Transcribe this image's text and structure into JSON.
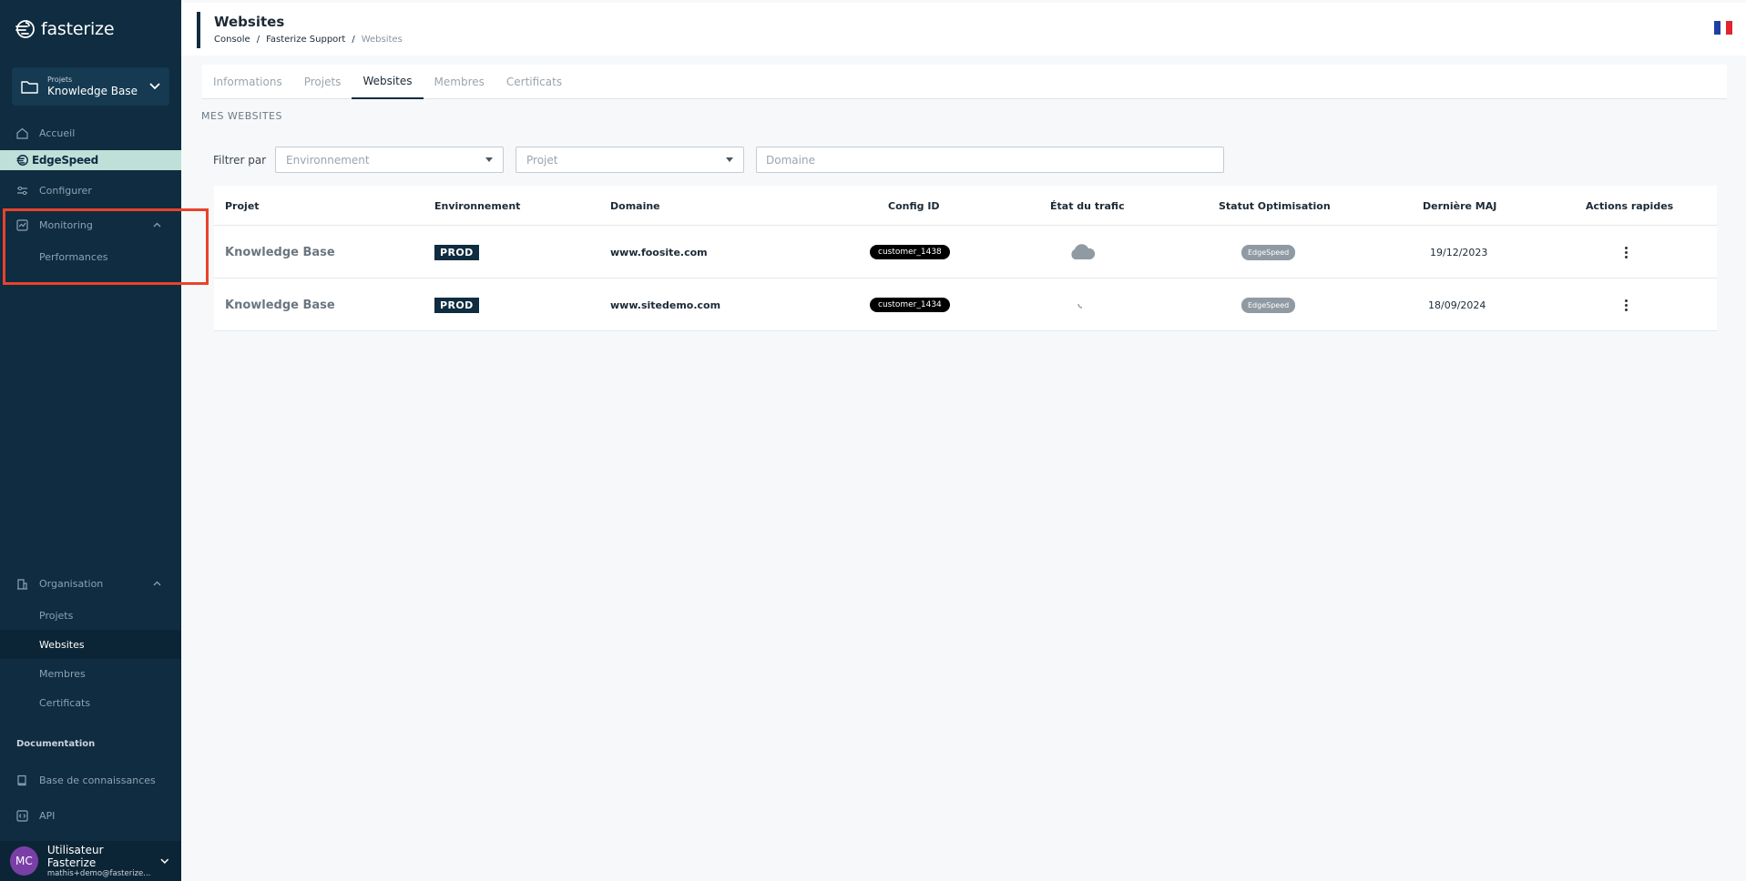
{
  "sidebar": {
    "logo_text": "fasterize",
    "project_select": {
      "small_label": "Projets",
      "value": "Knowledge Base"
    },
    "nav": {
      "accueil": "Accueil",
      "edgespeed": "EdgeSpeed",
      "configurer": "Configurer",
      "monitoring": "Monitoring",
      "performances": "Performances",
      "organisation": "Organisation",
      "projets": "Projets",
      "websites": "Websites",
      "membres": "Membres",
      "certificats": "Certificats"
    },
    "documentation": {
      "title": "Documentation",
      "base": "Base de connaissances",
      "api": "API"
    },
    "user": {
      "initials": "MC",
      "name": "Utilisateur Fasterize",
      "email": "mathis+demo@fasterize..."
    },
    "highlight_color": "#e8432b"
  },
  "header": {
    "title": "Websites",
    "breadcrumb": [
      "Console",
      "Fasterize Support",
      "Websites"
    ],
    "breadcrumb_sep": "/"
  },
  "tabs": [
    "Informations",
    "Projets",
    "Websites",
    "Membres",
    "Certificats"
  ],
  "active_tab": "Websites",
  "section_title": "MES WEBSITES",
  "filters": {
    "label": "Filtrer par",
    "environnement_placeholder": "Environnement",
    "projet_placeholder": "Projet",
    "domaine_placeholder": "Domaine"
  },
  "table": {
    "columns": [
      "Projet",
      "Environnement",
      "Domaine",
      "Config ID",
      "État du trafic",
      "Statut Optimisation",
      "Dernière MAJ",
      "Actions rapides"
    ],
    "rows": [
      {
        "projet": "Knowledge Base",
        "environnement": "PROD",
        "domaine": "www.foosite.com",
        "config_id": "customer_1438",
        "etat_trafic": "cloud-icon",
        "statut": "EdgeSpeed",
        "derniere_maj": "19/12/2023"
      },
      {
        "projet": "Knowledge Base",
        "environnement": "PROD",
        "domaine": "www.sitedemo.com",
        "config_id": "customer_1434",
        "etat_trafic": "loading-icon",
        "statut": "EdgeSpeed",
        "derniere_maj": "18/09/2024"
      }
    ]
  },
  "colors": {
    "sidebar_bg": "#0f2c40",
    "edgespeed_bg": "#bfdfd9",
    "accent": "#0f2c40"
  }
}
